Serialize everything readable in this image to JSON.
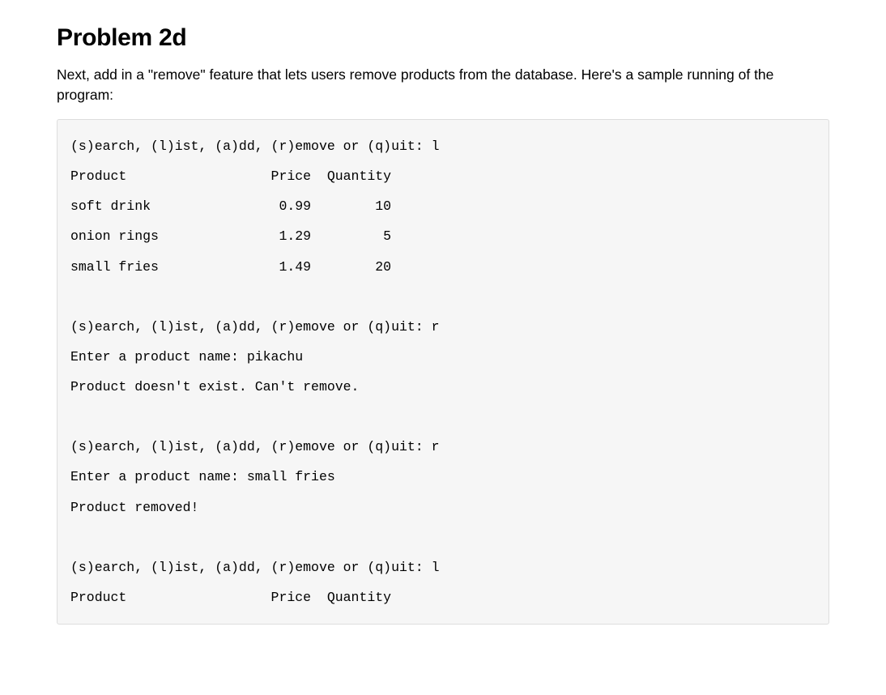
{
  "heading": "Problem 2d",
  "description": "Next, add in a \"remove\" feature that lets users remove products from the database. Here's a sample running of the program:",
  "code_output": "(s)earch, (l)ist, (a)dd, (r)emove or (q)uit: l\nProduct                  Price  Quantity\nsoft drink                0.99        10\nonion rings               1.29         5\nsmall fries               1.49        20\n\n(s)earch, (l)ist, (a)dd, (r)emove or (q)uit: r\nEnter a product name: pikachu\nProduct doesn't exist. Can't remove.\n\n(s)earch, (l)ist, (a)dd, (r)emove or (q)uit: r\nEnter a product name: small fries\nProduct removed!\n\n(s)earch, (l)ist, (a)dd, (r)emove or (q)uit: l\nProduct                  Price  Quantity"
}
